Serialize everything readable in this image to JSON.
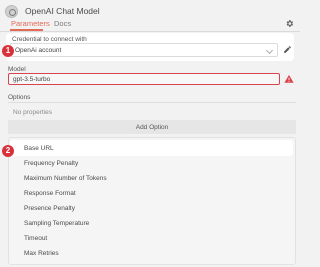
{
  "header": {
    "title": "OpenAI Chat Model",
    "tabs": [
      {
        "label": "Parameters"
      },
      {
        "label": "Docs"
      }
    ]
  },
  "credential": {
    "label": "Credential to connect with",
    "value": "OpenAi account"
  },
  "model": {
    "label": "Model",
    "value": "gpt-3.5-turbo"
  },
  "options": {
    "label": "Options",
    "empty_text": "No properties",
    "add_label": "Add Option"
  },
  "dropdown": {
    "items": [
      {
        "label": "Base URL"
      },
      {
        "label": "Frequency Penalty"
      },
      {
        "label": "Maximum Number of Tokens"
      },
      {
        "label": "Response Format"
      },
      {
        "label": "Presence Penalty"
      },
      {
        "label": "Sampling Temperature"
      },
      {
        "label": "Timeout"
      },
      {
        "label": "Max Retries"
      }
    ]
  },
  "annotations": {
    "badge_1": "1",
    "badge_2": "2"
  },
  "colors": {
    "accent": "#e36b56",
    "error": "#d9434d",
    "badge": "#d8313b"
  }
}
